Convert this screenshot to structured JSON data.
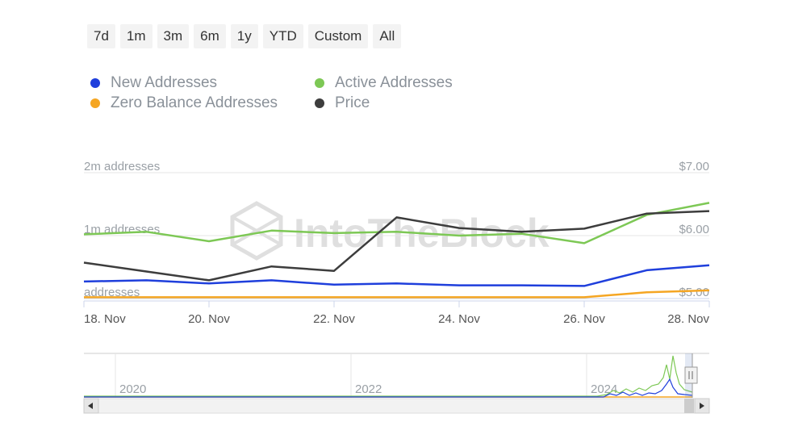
{
  "range_buttons": [
    "7d",
    "1m",
    "3m",
    "6m",
    "1y",
    "YTD",
    "Custom",
    "All"
  ],
  "legend": [
    {
      "label": "New Addresses",
      "color": "#1f3fdc"
    },
    {
      "label": "Active Addresses",
      "color": "#7dc855"
    },
    {
      "label": "Zero Balance Addresses",
      "color": "#f5a623"
    },
    {
      "label": "Price",
      "color": "#3d3d3d"
    }
  ],
  "watermark": "IntoTheBlock",
  "chart_data": {
    "type": "line",
    "x": [
      "18 Nov",
      "19 Nov",
      "20 Nov",
      "21 Nov",
      "22 Nov",
      "23 Nov",
      "24 Nov",
      "25 Nov",
      "26 Nov",
      "27 Nov",
      "28 Nov"
    ],
    "x_tick_labels": [
      "18. Nov",
      "20. Nov",
      "22. Nov",
      "24. Nov",
      "26. Nov",
      "28. Nov"
    ],
    "left_axis": {
      "tick_labels": [
        "addresses",
        "1m addresses",
        "2m addresses"
      ],
      "range": [
        0,
        2000000
      ]
    },
    "right_axis": {
      "tick_labels": [
        "$5.00",
        "$6.00",
        "$7.00"
      ],
      "range": [
        5,
        7
      ]
    },
    "series": [
      {
        "name": "New Addresses",
        "axis": "left",
        "color": "#1f3fdc",
        "values": [
          270000,
          290000,
          240000,
          290000,
          220000,
          240000,
          210000,
          210000,
          200000,
          450000,
          530000
        ]
      },
      {
        "name": "Active Addresses",
        "axis": "left",
        "color": "#7dc855",
        "values": [
          1020000,
          1060000,
          910000,
          1080000,
          1040000,
          1060000,
          1000000,
          1030000,
          880000,
          1330000,
          1520000
        ]
      },
      {
        "name": "Zero Balance Addresses",
        "axis": "left",
        "color": "#f5a623",
        "values": [
          20000,
          20000,
          20000,
          20000,
          20000,
          20000,
          20000,
          20000,
          20000,
          100000,
          130000
        ]
      },
      {
        "name": "Price",
        "axis": "right",
        "color": "#3d3d3d",
        "values": [
          5.57,
          5.43,
          5.29,
          5.51,
          5.44,
          6.29,
          6.12,
          6.06,
          6.11,
          6.35,
          6.39
        ]
      }
    ],
    "navigator": {
      "tick_labels": [
        "2020",
        "2022",
        "2024"
      ]
    }
  }
}
